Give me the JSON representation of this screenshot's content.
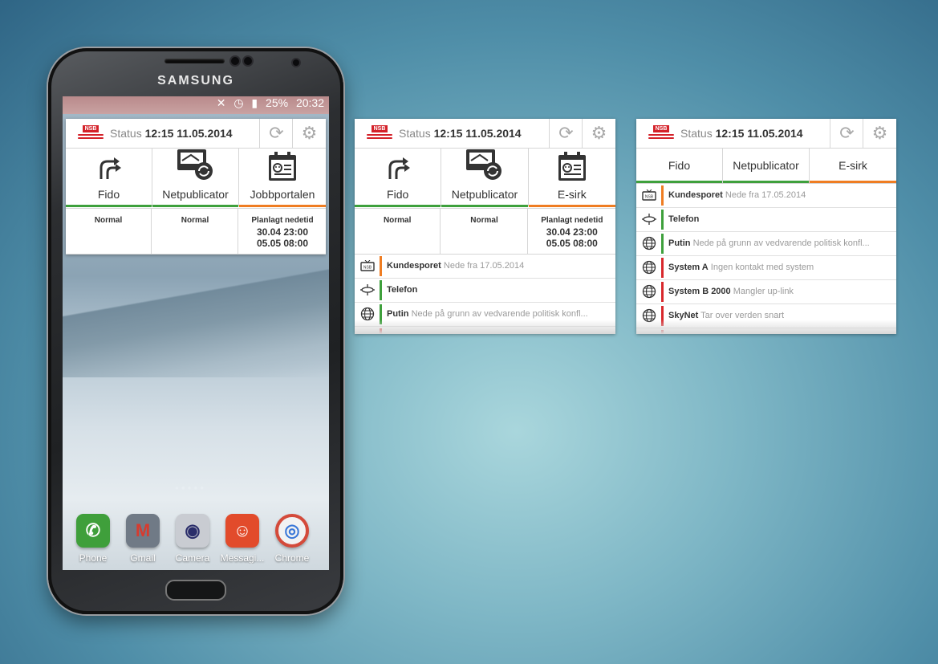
{
  "colors": {
    "green": "#3ea03c",
    "orange": "#ef7d22",
    "red": "#d8282c",
    "nsb_red": "#d4222a"
  },
  "phone": {
    "brand": "SAMSUNG",
    "status_bar": {
      "battery": "25%",
      "time": "20:32"
    },
    "dock": [
      {
        "label": "Phone",
        "icon": "phone-icon",
        "color": "#3f9f3b"
      },
      {
        "label": "Gmail",
        "icon": "gmail-icon",
        "color": "#707a86"
      },
      {
        "label": "Camera",
        "icon": "camera-icon",
        "color": "#c9ccd2"
      },
      {
        "label": "Messagi...",
        "icon": "message-icon",
        "color": "#e24b2b"
      },
      {
        "label": "Chrome",
        "icon": "chrome-icon",
        "color": "#f2f2f2"
      }
    ]
  },
  "widgets": [
    {
      "logo": "NSB",
      "status_label": "Status",
      "status_time": "12:15 11.05.2014",
      "tiles": [
        {
          "label": "Fido",
          "icon": "fork-arrows-icon",
          "state": "Normal",
          "color": "green"
        },
        {
          "label": "Netpublicator",
          "icon": "sync-screen-icon",
          "state": "Normal",
          "color": "green"
        },
        {
          "label": "Jobbportalen",
          "icon": "id-card-icon",
          "state": "Planlagt nedetid",
          "dates": [
            "30.04 23:00",
            "05.05 08:00"
          ],
          "color": "orange"
        }
      ]
    },
    {
      "logo": "NSB",
      "status_label": "Status",
      "status_time": "12:15 11.05.2014",
      "tiles": [
        {
          "label": "Fido",
          "icon": "fork-arrows-icon",
          "state": "Normal",
          "color": "green"
        },
        {
          "label": "Netpublicator",
          "icon": "sync-screen-icon",
          "state": "Normal",
          "color": "green"
        },
        {
          "label": "E-sirk",
          "icon": "id-card-icon",
          "state": "Planlagt nedetid",
          "dates": [
            "30.04 23:00",
            "05.05 08:00"
          ],
          "color": "orange"
        }
      ],
      "list": [
        {
          "name": "Kundesporet",
          "detail": "Nede fra 17.05.2014",
          "icon": "tv-icon",
          "color": "orange"
        },
        {
          "name": "Telefon",
          "detail": "",
          "icon": "network-icon",
          "color": "green"
        },
        {
          "name": "Putin",
          "detail": "Nede på grunn av vedvarende politisk konfl...",
          "icon": "globe-icon",
          "color": "green"
        }
      ]
    },
    {
      "logo": "NSB",
      "status_label": "Status",
      "status_time": "12:15 11.05.2014",
      "tabs": [
        {
          "label": "Fido",
          "color": "green"
        },
        {
          "label": "Netpublicator",
          "color": "green"
        },
        {
          "label": "E-sirk",
          "color": "orange"
        }
      ],
      "list": [
        {
          "name": "Kundesporet",
          "detail": "Nede fra 17.05.2014",
          "icon": "tv-icon",
          "color": "orange"
        },
        {
          "name": "Telefon",
          "detail": "",
          "icon": "network-icon",
          "color": "green"
        },
        {
          "name": "Putin",
          "detail": "Nede på grunn av vedvarende politisk konfl...",
          "icon": "globe-icon",
          "color": "green"
        },
        {
          "name": "System A",
          "detail": "Ingen kontakt med system",
          "icon": "globe-icon",
          "color": "red"
        },
        {
          "name": "System B 2000",
          "detail": "Mangler up-link",
          "icon": "globe-icon",
          "color": "red"
        },
        {
          "name": "SkyNet",
          "detail": "Tar over verden snart",
          "icon": "globe-icon",
          "color": "red"
        }
      ]
    }
  ]
}
